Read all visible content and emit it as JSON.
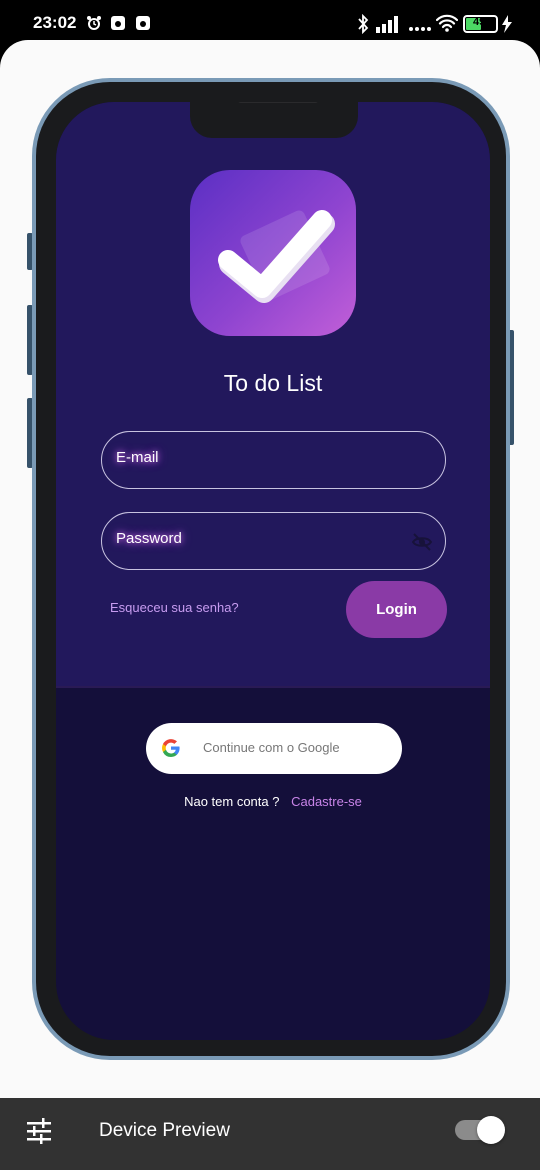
{
  "status_bar": {
    "time": "23:02",
    "battery": "49",
    "icons": [
      "alarm-icon",
      "app-icon",
      "app-icon",
      "bluetooth-icon",
      "signal-icon",
      "wifi-icon",
      "battery-icon",
      "charging-icon"
    ]
  },
  "app": {
    "title": "To do List",
    "email_label": "E-mail",
    "password_label": "Password",
    "forgot_password": "Esqueceu sua senha?",
    "login_button": "Login",
    "google_button": "Continue com o Google",
    "no_account": "Nao tem conta ?",
    "signup_link": "Cadastre-se"
  },
  "bottom_bar": {
    "label": "Device Preview",
    "toggle_on": true
  },
  "colors": {
    "screen_top": "#22185c",
    "screen_bottom": "#140f3a",
    "accent": "#8a3aa6",
    "link": "#c884e8"
  }
}
